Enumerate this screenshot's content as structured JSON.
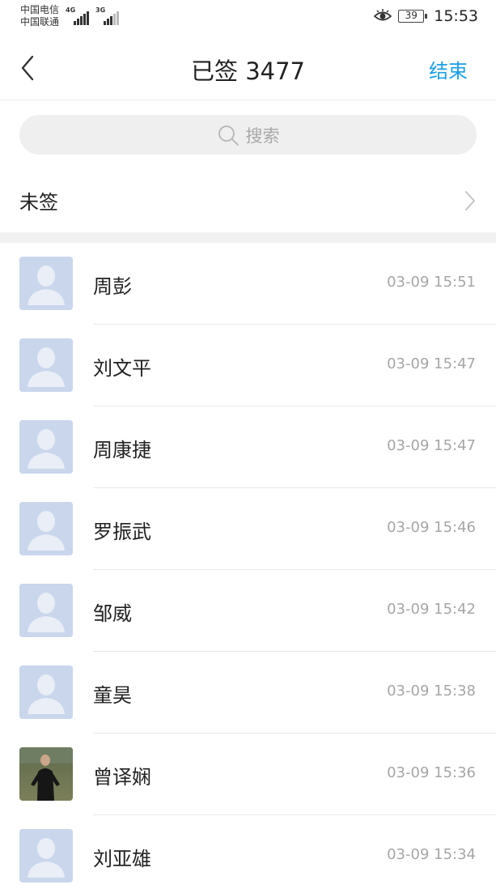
{
  "status_bar": {
    "carrier_1": "中国电信",
    "carrier_2": "中国联通",
    "network_1": "4G",
    "network_2": "3G",
    "battery": "39",
    "time": "15:53"
  },
  "header": {
    "title": "已签 3477",
    "end_label": "结束"
  },
  "search": {
    "placeholder": "搜索"
  },
  "unsigned": {
    "label": "未签"
  },
  "colors": {
    "accent": "#1aa0e8",
    "avatar_placeholder": "#c9d6ec"
  },
  "list": [
    {
      "name": "周彭",
      "time": "03-09 15:51",
      "avatar": "placeholder"
    },
    {
      "name": "刘文平",
      "time": "03-09 15:47",
      "avatar": "placeholder"
    },
    {
      "name": "周康捷",
      "time": "03-09 15:47",
      "avatar": "placeholder"
    },
    {
      "name": "罗振武",
      "time": "03-09 15:46",
      "avatar": "placeholder"
    },
    {
      "name": "邹威",
      "time": "03-09 15:42",
      "avatar": "placeholder"
    },
    {
      "name": "童昊",
      "time": "03-09 15:38",
      "avatar": "placeholder"
    },
    {
      "name": "曾译娴",
      "time": "03-09 15:36",
      "avatar": "photo"
    },
    {
      "name": "刘亚雄",
      "time": "03-09 15:34",
      "avatar": "placeholder"
    }
  ]
}
